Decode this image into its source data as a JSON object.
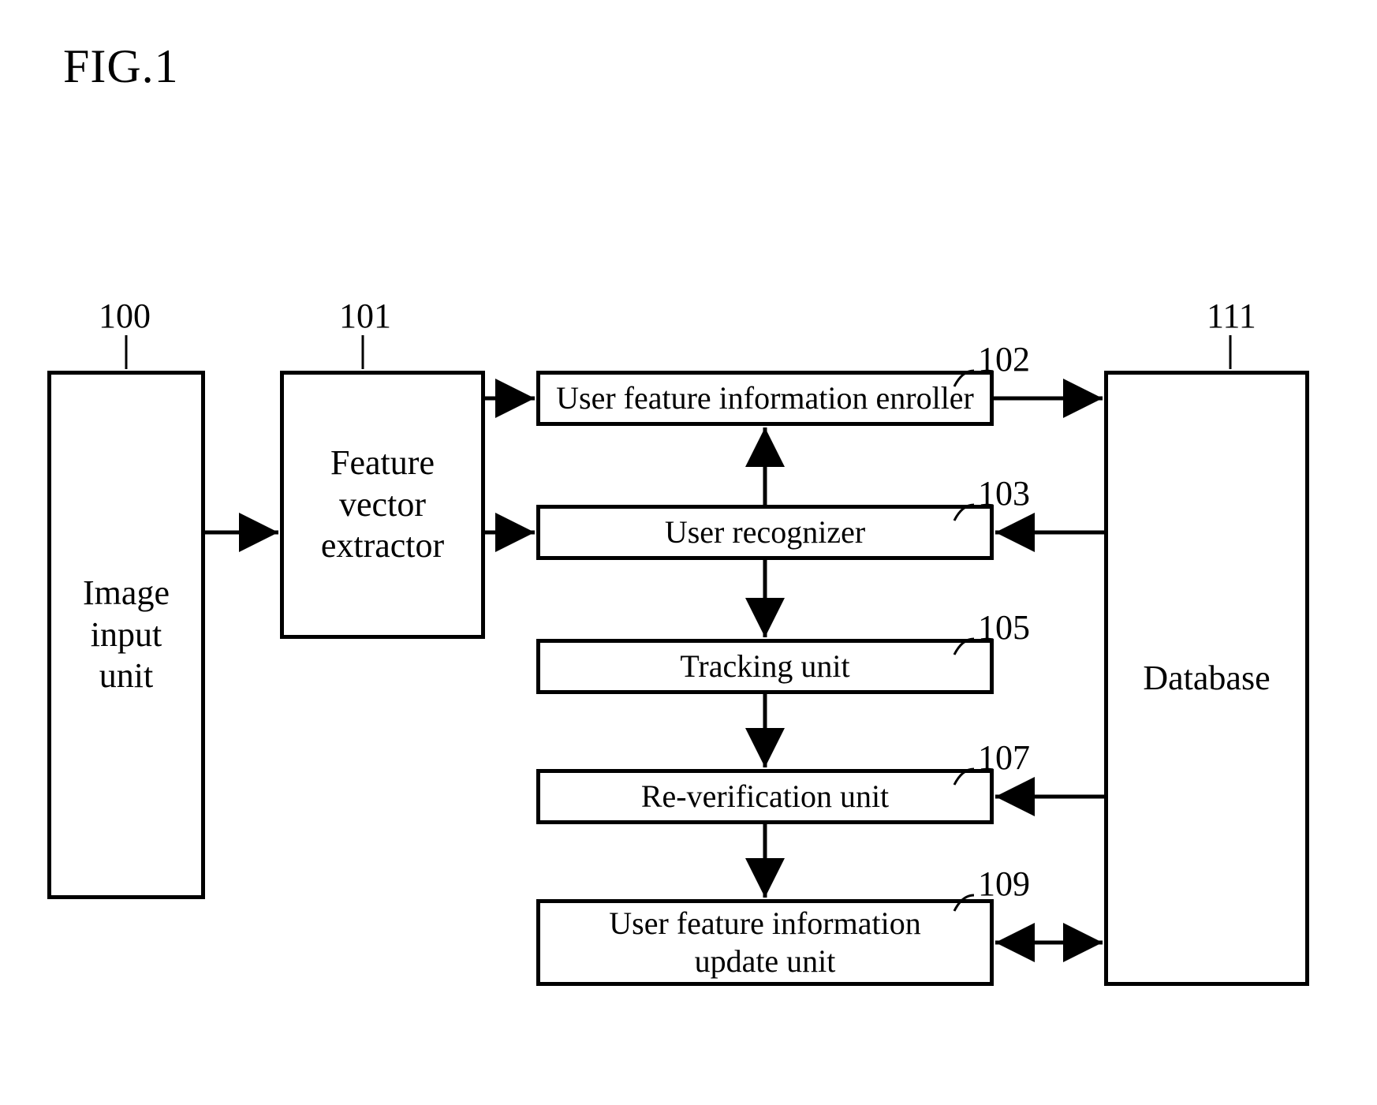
{
  "title": "FIG.1",
  "blocks": {
    "b100": {
      "ref": "100",
      "label": "Image\ninput\nunit"
    },
    "b101": {
      "ref": "101",
      "label": "Feature\nvector\nextractor"
    },
    "b102": {
      "ref": "102",
      "label": "User feature information enroller"
    },
    "b103": {
      "ref": "103",
      "label": "User recognizer"
    },
    "b105": {
      "ref": "105",
      "label": "Tracking unit"
    },
    "b107": {
      "ref": "107",
      "label": "Re-verification unit"
    },
    "b109": {
      "ref": "109",
      "label": "User feature information\nupdate unit"
    },
    "b111": {
      "ref": "111",
      "label": "Database"
    }
  },
  "connections": [
    {
      "from": "b100",
      "to": "b101",
      "dir": "right"
    },
    {
      "from": "b101",
      "to": "b102",
      "dir": "right"
    },
    {
      "from": "b101",
      "to": "b103",
      "dir": "right"
    },
    {
      "from": "b102",
      "to": "b111",
      "dir": "right"
    },
    {
      "from": "b111",
      "to": "b103",
      "dir": "left"
    },
    {
      "from": "b111",
      "to": "b107",
      "dir": "left"
    },
    {
      "from": "b109",
      "to": "b111",
      "dir": "both"
    },
    {
      "from": "b103",
      "to": "b102",
      "dir": "up"
    },
    {
      "from": "b103",
      "to": "b105",
      "dir": "down"
    },
    {
      "from": "b105",
      "to": "b107",
      "dir": "down"
    },
    {
      "from": "b107",
      "to": "b109",
      "dir": "down"
    }
  ]
}
